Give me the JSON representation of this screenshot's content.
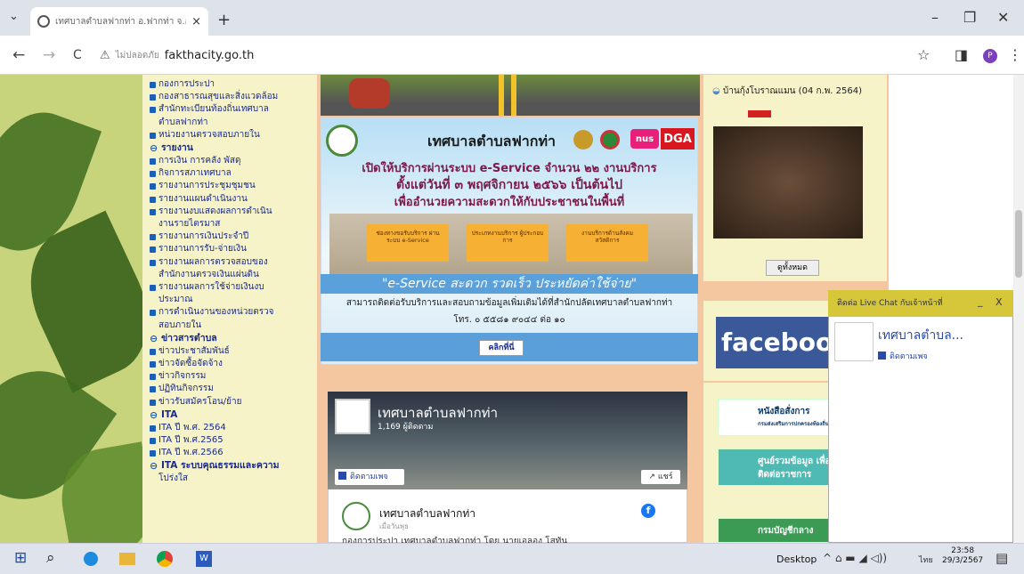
{
  "browser": {
    "tab_title": "เทศบาลตำบลฟากท่า อ.ฟากท่า จ.อุตรดิตถ์ - ...",
    "tab_close": "×",
    "new_tab": "+",
    "tab_search": "⌄",
    "not_secure": "ไม่ปลอดภัย",
    "url": "fakthacity.go.th",
    "win_min": "–",
    "win_max": "❐",
    "win_close": "✕",
    "back": "←",
    "forward": "→",
    "reload": "C",
    "warn_icon": "⚠",
    "star": "☆",
    "sidebar_icon": "◨",
    "profile": "P",
    "menu": "⋮"
  },
  "menu": {
    "items": [
      {
        "type": "item",
        "label": "กองการประปา"
      },
      {
        "type": "item",
        "label": "กองสาธารณสุขและสิ่งแวดล้อม"
      },
      {
        "type": "item",
        "label": "สำนักทะเบียนท้องถิ่นเทศบาล"
      },
      {
        "type": "cont",
        "label": "ตำบลฟากท่า"
      },
      {
        "type": "item",
        "label": "หน่วยงานตรวจสอบภายใน"
      },
      {
        "type": "head",
        "label": "รายงาน"
      },
      {
        "type": "item",
        "label": "การเงิน การคลัง พัสดุ"
      },
      {
        "type": "item",
        "label": "กิจการสภาเทศบาล"
      },
      {
        "type": "item",
        "label": "รายงานการประชุมชุมชน"
      },
      {
        "type": "item",
        "label": "รายงานแผนดำเนินงาน"
      },
      {
        "type": "item",
        "label": "รายงานงบแสดงผลการดำเนิน"
      },
      {
        "type": "cont",
        "label": "งานรายไตรมาส"
      },
      {
        "type": "item",
        "label": "รายงานการเงินประจำปี"
      },
      {
        "type": "item",
        "label": "รายงานการรับ-จ่ายเงิน"
      },
      {
        "type": "item",
        "label": "รายงานผลการตรวจสอบของ"
      },
      {
        "type": "cont",
        "label": "สำนักงานตรวจเงินแผ่นดิน"
      },
      {
        "type": "item",
        "label": "รายงานผลการใช้จ่ายเงินงบ"
      },
      {
        "type": "cont",
        "label": "ประมาณ"
      },
      {
        "type": "item",
        "label": "การดำเนินงานของหน่วยตรวจ"
      },
      {
        "type": "cont",
        "label": "สอบภายใน"
      },
      {
        "type": "head",
        "label": "ข่าวสารตำบล"
      },
      {
        "type": "item",
        "label": "ข่าวประชาสัมพันธ์"
      },
      {
        "type": "item",
        "label": "ข่าวจัดซื้อจัดจ้าง"
      },
      {
        "type": "item",
        "label": "ข่าวกิจกรรม"
      },
      {
        "type": "item",
        "label": "ปฏิทินกิจกรรม"
      },
      {
        "type": "item",
        "label": "ข่าวรับสมัครโอน/ย้าย"
      },
      {
        "type": "head",
        "label": "ITA"
      },
      {
        "type": "item",
        "label": "ITA ปี พ.ศ. 2564"
      },
      {
        "type": "item",
        "label": "ITA ปี พ.ศ.2565"
      },
      {
        "type": "item",
        "label": "ITA ปี พ.ศ.2566"
      },
      {
        "type": "head",
        "label": "ITA ระบบคุณธรรมและความ"
      },
      {
        "type": "cont",
        "label": "โปร่งใส"
      }
    ]
  },
  "banner": {
    "title": "เทศบาลตำบลฟากท่า",
    "nus": "nus",
    "dga": "DGA",
    "line1": "เปิดให้บริการผ่านระบบ e-Service จำนวน ๒๒ งานบริการ",
    "line2": "ตั้งแต่วันที่ ๓ พฤศจิกายน ๒๕๖๖ เป็นต้นไป",
    "line3": "เพื่ออำนวยความสะดวกให้กับประชาชนในพื้นที่",
    "services": [
      "ช่องทางขอรับบริการ ผ่านระบบ e-Service",
      "ประเภทงานบริการ ผู้ประกอบการ",
      "งานบริการด้านสังคม สวัสดิการ"
    ],
    "eservice": "\"e-Service  สะดวก รวดเร็ว ประหยัดค่าใช้จ่าย\"",
    "contact": "สามารถติดต่อรับบริการและสอบถามข้อมูลเพิ่มเติมได้ที่สำนักปลัดเทศบาลตำบลฟากท่า",
    "phone": "โทร. ๐ ๕๕๘๑ ๙๐๔๔ ต่อ ๑๐",
    "click": "คลิกที่นี่"
  },
  "fb": {
    "page_name": "เทศบาลตำบลฟากท่า",
    "followers": "1,169 ผู้ติดตาม",
    "follow": "ติดตามเพจ",
    "share": "แชร์",
    "post_name": "เทศบาลตำบลฟากท่า",
    "post_time": "เมื่อวันพุธ",
    "post_text": "กองการประปา เทศบาลตำบลฟากท่า โดย นายเอลอง โสทัน",
    "post_icon": "f"
  },
  "right": {
    "photo_title": "บ้านกุ้งโบราณแมน (04 ก.พ. 2564)",
    "see_all": "ดูทั้งหมด",
    "facebook": "facebook",
    "link1": "หนังสือสั่งการ",
    "link1_sub": "กรมส่งเสริมการปกครองท้องถิ่น",
    "link2": "ศูนย์รวมข้อมูล เพื่อติดต่อราชการ",
    "link3": "กรมบัญชีกลาง"
  },
  "chat": {
    "header": "ติดต่อ Live Chat กับเจ้าหน้าที่",
    "min": "_",
    "close": "X",
    "name": "เทศบาลตำบล...",
    "follow": "ติดตามเพจ"
  },
  "taskbar": {
    "start": "⊞",
    "search": "⌕",
    "desktop": "Desktop",
    "tray": "^  ⌂  ▬  ◢  ◁))",
    "lang": "ไทย",
    "time": "23:58",
    "date": "29/3/2567",
    "notif": "▤"
  }
}
